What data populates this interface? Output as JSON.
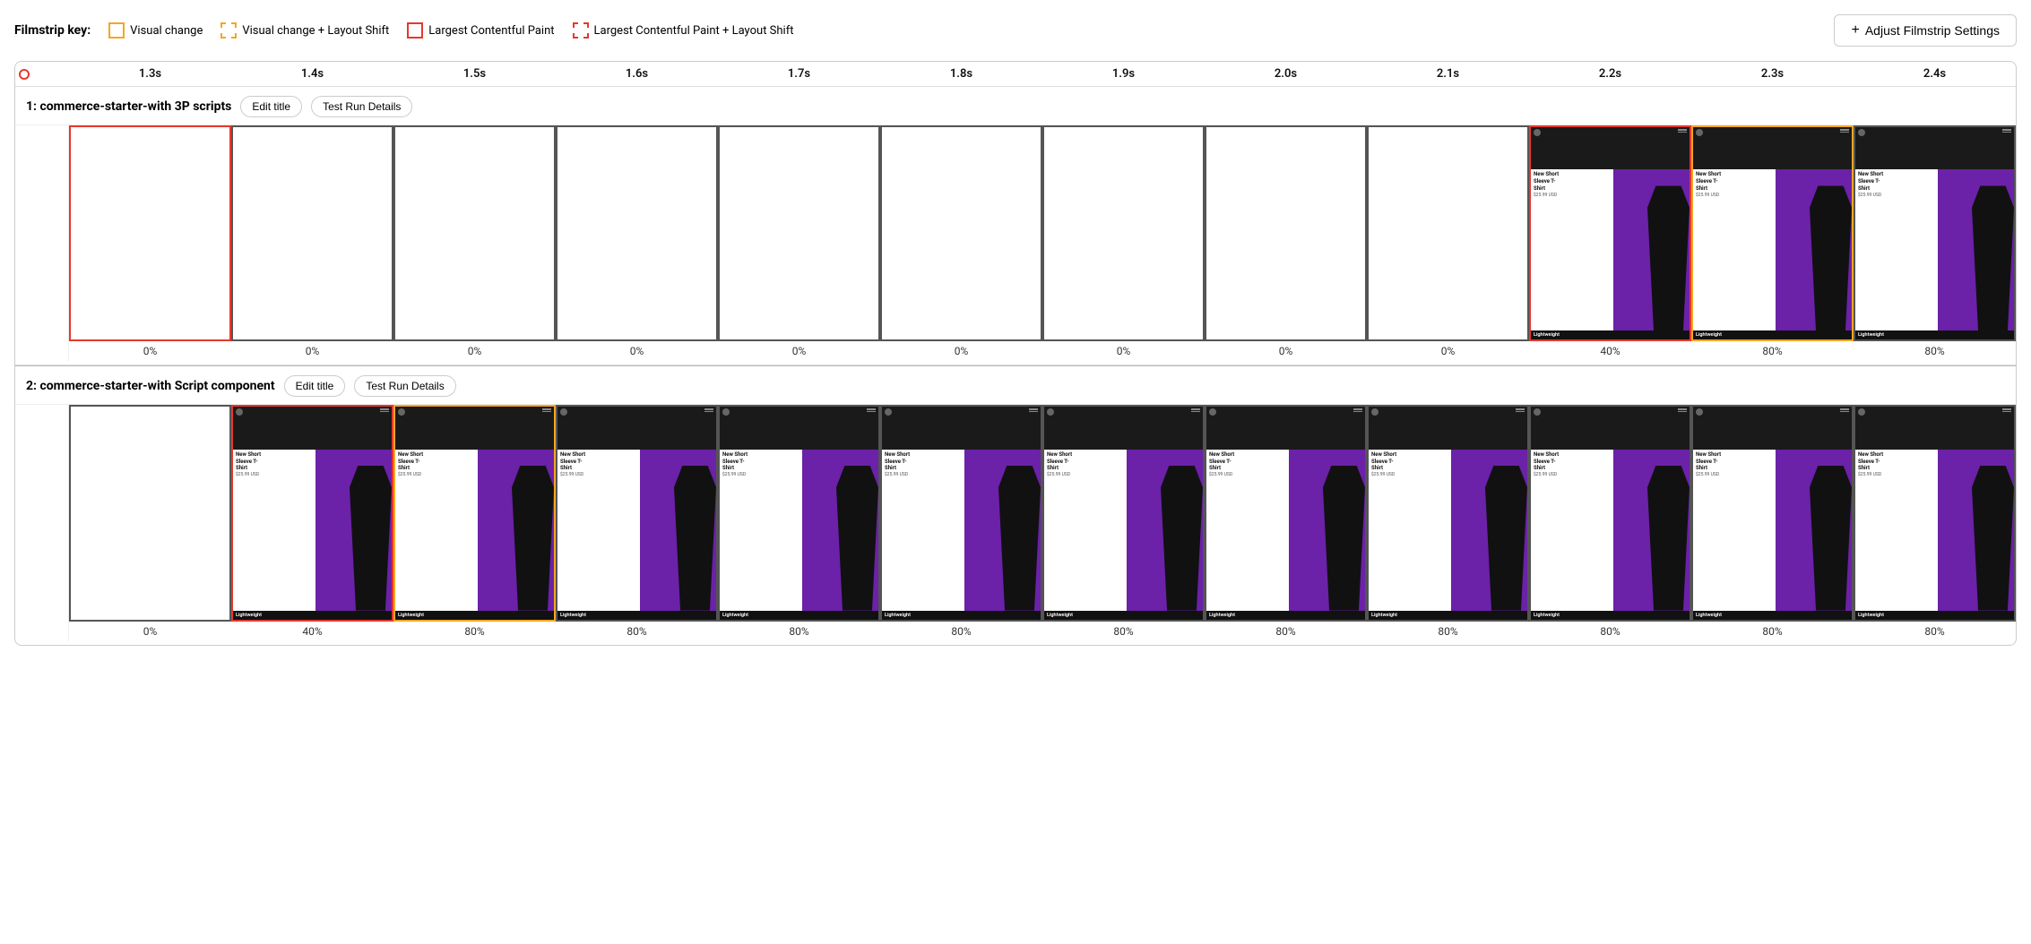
{
  "legend": {
    "label": "Filmstrip key:",
    "items": [
      {
        "id": "visual-change",
        "type": "solid-yellow",
        "text": "Visual change"
      },
      {
        "id": "visual-change-layout-shift",
        "type": "dashed-yellow",
        "text": "Visual change + Layout Shift"
      },
      {
        "id": "lcp",
        "type": "solid-red",
        "text": "Largest Contentful Paint"
      },
      {
        "id": "lcp-layout-shift",
        "type": "dashed-red",
        "text": "Largest Contentful Paint + Layout Shift"
      }
    ],
    "adjust_button": "Adjust Filmstrip Settings"
  },
  "timeline": {
    "ticks": [
      "1.3s",
      "1.4s",
      "1.5s",
      "1.6s",
      "1.7s",
      "1.8s",
      "1.9s",
      "2.0s",
      "2.1s",
      "2.2s",
      "2.3s",
      "2.4s"
    ]
  },
  "rows": [
    {
      "id": "row1",
      "label": "1: commerce-starter-with 3P scripts",
      "edit_title": "Edit title",
      "test_run": "Test Run Details",
      "frames": [
        {
          "border": "red",
          "empty": true,
          "pct": "0%"
        },
        {
          "border": "none",
          "empty": true,
          "pct": "0%"
        },
        {
          "border": "none",
          "empty": true,
          "pct": "0%"
        },
        {
          "border": "none",
          "empty": true,
          "pct": "0%"
        },
        {
          "border": "none",
          "empty": true,
          "pct": "0%"
        },
        {
          "border": "none",
          "empty": true,
          "pct": "0%"
        },
        {
          "border": "none",
          "empty": true,
          "pct": "0%"
        },
        {
          "border": "none",
          "empty": true,
          "pct": "0%"
        },
        {
          "border": "none",
          "empty": true,
          "pct": "0%"
        },
        {
          "border": "red",
          "empty": false,
          "pct": "40%"
        },
        {
          "border": "yellow",
          "empty": false,
          "pct": "80%"
        },
        {
          "border": "none",
          "empty": false,
          "pct": "80%"
        }
      ]
    },
    {
      "id": "row2",
      "label": "2: commerce-starter-with Script component",
      "edit_title": "Edit title",
      "test_run": "Test Run Details",
      "frames": [
        {
          "border": "none",
          "empty": true,
          "pct": "0%"
        },
        {
          "border": "red",
          "empty": false,
          "pct": "40%"
        },
        {
          "border": "yellow",
          "empty": false,
          "pct": "80%"
        },
        {
          "border": "none",
          "empty": false,
          "pct": "80%"
        },
        {
          "border": "none",
          "empty": false,
          "pct": "80%"
        },
        {
          "border": "none",
          "empty": false,
          "pct": "80%"
        },
        {
          "border": "none",
          "empty": false,
          "pct": "80%"
        },
        {
          "border": "none",
          "empty": false,
          "pct": "80%"
        },
        {
          "border": "none",
          "empty": false,
          "pct": "80%"
        },
        {
          "border": "none",
          "empty": false,
          "pct": "80%"
        },
        {
          "border": "none",
          "empty": false,
          "pct": "80%"
        },
        {
          "border": "none",
          "empty": false,
          "pct": "80%"
        }
      ]
    }
  ],
  "screenshot": {
    "title": "New Short Sleeve T-Shirt",
    "price": "$25.99 USD",
    "bottom": "Lightweight"
  }
}
